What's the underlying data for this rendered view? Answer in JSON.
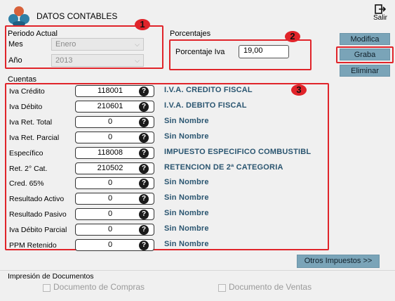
{
  "header": {
    "title": "DATOS CONTABLES",
    "exit_label": "Salir"
  },
  "periodo": {
    "title": "Periodo Actual",
    "mes_label": "Mes",
    "mes_value": "Enero",
    "anio_label": "Año",
    "anio_value": "2013"
  },
  "porcentajes": {
    "title": "Porcentajes",
    "iva_label": "Porcentaje Iva",
    "iva_value": "19,00"
  },
  "actions": {
    "modifica": "Modifica",
    "graba": "Graba",
    "eliminar": "Eliminar"
  },
  "badges": [
    "1",
    "2",
    "3"
  ],
  "cuentas": {
    "title": "Cuentas",
    "help_glyph": "?",
    "rows": [
      {
        "label": "Iva Crédito",
        "code": "118001",
        "name": "I.V.A. CREDITO FISCAL"
      },
      {
        "label": "Iva Débito",
        "code": "210601",
        "name": "I.V.A. DEBITO FISCAL"
      },
      {
        "label": "Iva Ret. Total",
        "code": "0",
        "name": "Sin Nombre"
      },
      {
        "label": "Iva Ret. Parcial",
        "code": "0",
        "name": "Sin Nombre"
      },
      {
        "label": "Específico",
        "code": "118008",
        "name": "IMPUESTO ESPECIFICO COMBUSTIBL"
      },
      {
        "label": "Ret. 2° Cat.",
        "code": "210502",
        "name": "RETENCION DE 2ª CATEGORIA"
      },
      {
        "label": "Cred. 65%",
        "code": "0",
        "name": "Sin Nombre"
      },
      {
        "label": "Resultado Activo",
        "code": "0",
        "name": "Sin Nombre"
      },
      {
        "label": "Resultado Pasivo",
        "code": "0",
        "name": "Sin Nombre"
      },
      {
        "label": "Iva Débito Parcial",
        "code": "0",
        "name": "Sin Nombre"
      },
      {
        "label": "PPM Retenido",
        "code": "0",
        "name": "Sin Nombre"
      }
    ]
  },
  "otros_button": "Otros Impuestos >>",
  "impresion": {
    "title": "Impresión de Documentos",
    "compras": "Documento de Compras",
    "ventas": "Documento de Ventas"
  },
  "colors": {
    "accent_button": "#7aa4b8",
    "highlight_red": "#e0242a",
    "account_name": "#2a5570"
  },
  "icons": {
    "logo": "people-group-icon",
    "exit": "exit-door-icon",
    "help": "question-circle-icon"
  }
}
